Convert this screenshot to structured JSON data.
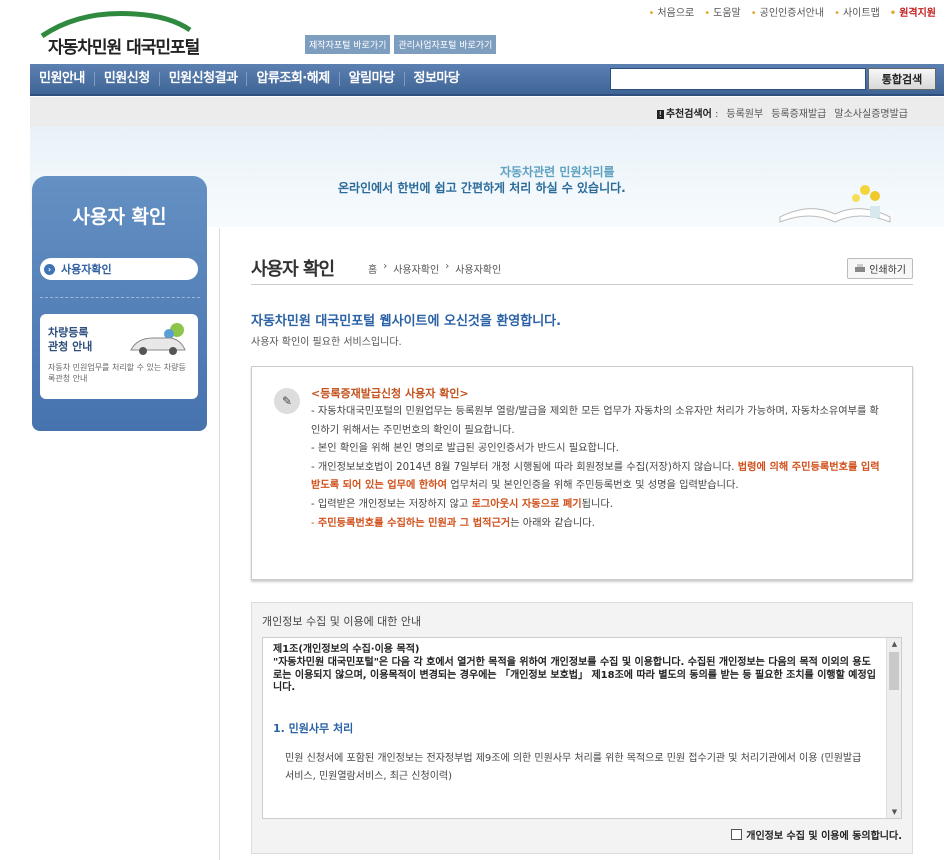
{
  "top_links": [
    "처음으로",
    "도움말",
    "공인인증서안내",
    "사이트맵",
    "원격지원"
  ],
  "logo": {
    "text": "자동차민원 대국민포털"
  },
  "quick_buttons": [
    "제작자포털 바로가기",
    "관리사업자포털 바로가기"
  ],
  "nav": {
    "items": [
      "민원안내",
      "민원신청",
      "민원신청결과",
      "압류조회·해제",
      "알림마당",
      "정보마당"
    ],
    "search_placeholder": "",
    "search_button": "통합검색"
  },
  "recommended": {
    "mark": "!",
    "label": "추천검색어",
    "terms": [
      "등록원부",
      "등록증재발급",
      "말소사실증명발급"
    ]
  },
  "banner": {
    "line1": "자동차관련 민원처리를",
    "line2": "온라인에서 한번에 쉽고 간편하게 처리 하실 수 있습니다."
  },
  "sidebar": {
    "title": "사용자 확인",
    "menu_item": "사용자확인",
    "card": {
      "title_line1": "차량등록",
      "title_line2": "관청 안내",
      "desc": "자동차 민원업무를 처리할 수 있는 차량등록관청 안내"
    }
  },
  "main": {
    "title": "사용자 확인",
    "breadcrumb": [
      "홈",
      "사용자확인",
      "사용자확인"
    ],
    "print_label": "인쇄하기",
    "welcome": "자동차민원 대국민포털 웹사이트에 오신것을 환영합니다.",
    "welcome_sub": "사용자 확인이 필요한 서비스입니다.",
    "notice": {
      "heading": "<등록증재발급신청 사용자 확인>",
      "p1": "- 자동차대국민포털의 민원업무는 등록원부 열람/발급을 제외한 모든 업무가 자동차의 소유자만 처리가 가능하며, 자동차소유여부를 확인하기 위해서는 주민번호의 확인이 필요합니다.",
      "p2": "- 본인 확인을 위해 본인 명의로 발급된 공인인증서가 반드시 필요합니다.",
      "p3a": "- 개인정보보호법이 2014년 8월 7일부터 개정 시행됨에 따라 회원정보를 수집(저장)하지 않습니다. ",
      "p3b": "법령에 의해 주민등록번호를 입력받도록 되어 있는 업무에 한하여",
      "p3c": " 업무처리 및 본인인증을 위해 주민등록번호 및 성명을 입력받습니다.",
      "p4a": "- 입력받은 개인정보는 저장하지 않고 ",
      "p4b": "로그아웃시 자동으로 폐기",
      "p4c": "됩니다.",
      "p5a": "- ",
      "p5b": "주민등록번호를 수집하는 민원과 그 법적근거",
      "p5c": "는 아래와 같습니다."
    },
    "privacy": {
      "header": "개인정보 수집 및 이용에 대한 안내",
      "article": "제1조(개인정보의 수집·이용 목적)",
      "article_body": "\"자동차민원 대국민포털\"은 다음 각 호에서 열거한 목적을 위하여 개인정보를 수집 및 이용합니다. 수집된 개인정보는 다음의 목적 이외의 용도로는 이용되지 않으며, 이용목적이 변경되는 경우에는 「개인정보 보호법」 제18조에 따라 별도의 동의를 받는 등 필요한 조치를 이행할 예정입니다.",
      "section_title": "1. 민원사무 처리",
      "section_body": "민원 신청서에 포함된 개인정보는 전자정부법 제9조에 의한 민원사무 처리를 위한 목적으로 민원 접수기관 및 처리기관에서 이용 (민원발급서비스, 민원열람서비스, 최근 신청이력)",
      "agree_label": "개인정보 수집 및 이용에 동의합니다."
    }
  },
  "colors": {
    "nav": "#4a70a3",
    "accent_orange": "#d0501b",
    "accent_blue": "#2b62a6"
  }
}
